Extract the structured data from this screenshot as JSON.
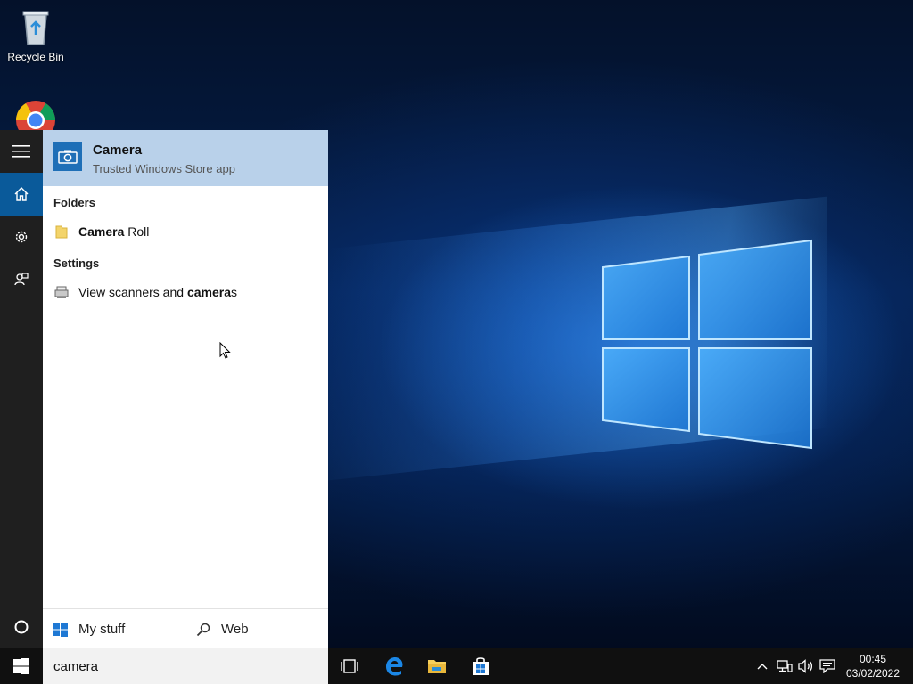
{
  "desktop": {
    "icons": [
      {
        "label": "Recycle Bin",
        "icon": "recycle-bin-icon"
      },
      {
        "label": "",
        "icon": "chrome-icon"
      }
    ]
  },
  "start_rail": {
    "items": [
      {
        "icon": "hamburger-menu-icon"
      },
      {
        "icon": "home-icon"
      },
      {
        "icon": "gear-icon"
      },
      {
        "icon": "feedback-icon"
      },
      {
        "icon": "cortana-circle-icon"
      }
    ]
  },
  "search": {
    "best_match": {
      "title": "Camera",
      "subtitle": "Trusted Windows Store app",
      "icon": "camera-icon"
    },
    "sections": [
      {
        "heading": "Folders",
        "results": [
          {
            "bold": "Camera",
            "rest": " Roll",
            "icon": "folder-icon"
          }
        ]
      },
      {
        "heading": "Settings",
        "results": [
          {
            "prefix": "View scanners and ",
            "bold": "camera",
            "suffix": "s",
            "icon": "scanner-icon"
          }
        ]
      }
    ],
    "scopes": {
      "my_stuff": "My stuff",
      "web": "Web"
    },
    "query": "camera"
  },
  "taskbar": {
    "pinned": [
      {
        "icon": "task-view-icon"
      },
      {
        "icon": "edge-icon"
      },
      {
        "icon": "file-explorer-icon"
      },
      {
        "icon": "store-icon"
      }
    ],
    "tray": [
      {
        "icon": "chevron-up-icon"
      },
      {
        "icon": "network-icon"
      },
      {
        "icon": "volume-icon"
      },
      {
        "icon": "action-center-icon"
      }
    ],
    "clock": {
      "time": "00:45",
      "date": "03/02/2022"
    }
  },
  "colors": {
    "accent": "#0a5a9a",
    "best_match_bg": "#b9d1ea",
    "taskbar": "#101010",
    "rail": "#1f1f1f"
  }
}
